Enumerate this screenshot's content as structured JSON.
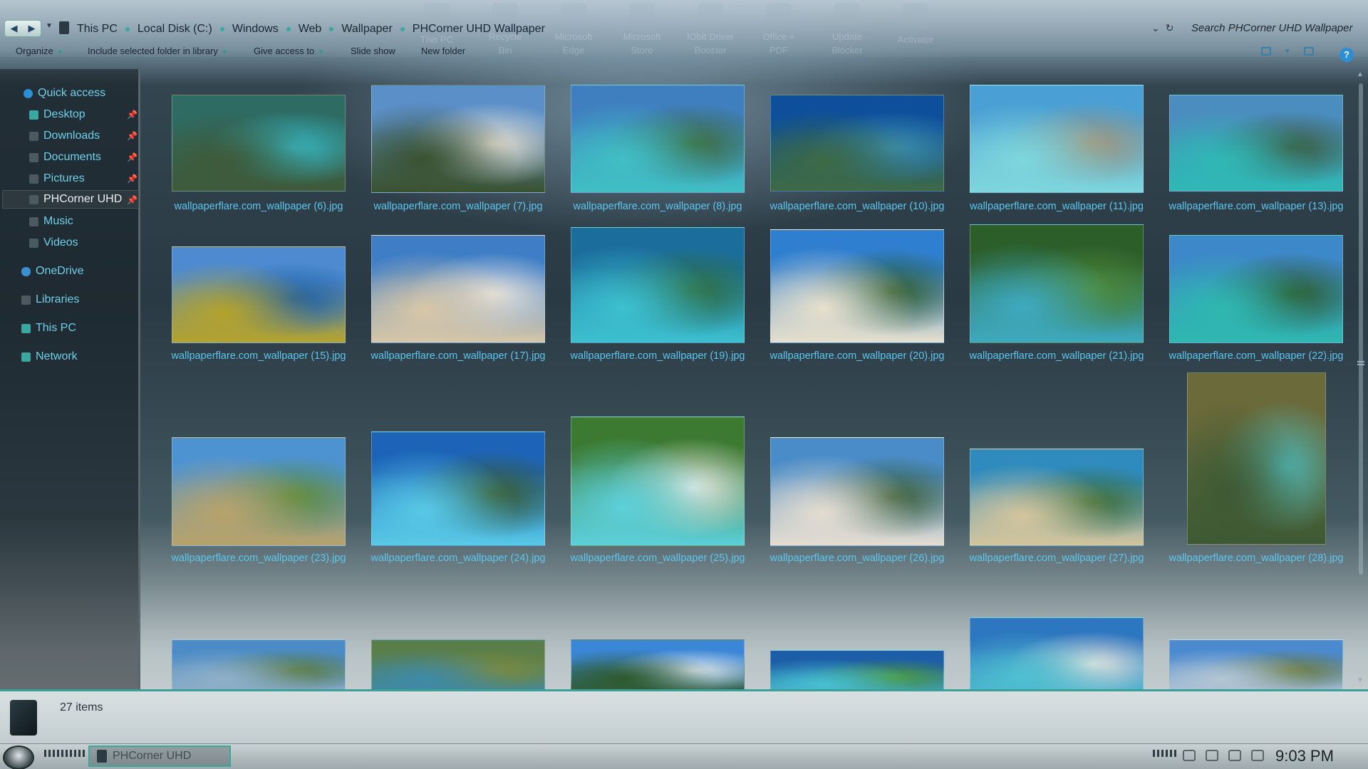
{
  "desktop_icons": [
    {
      "label": "This PC"
    },
    {
      "label": "Recycle Bin"
    },
    {
      "label": "Microsoft Edge"
    },
    {
      "label": "Microsoft Store"
    },
    {
      "label": "IObit Driver Booster"
    },
    {
      "label": "Office + PDF"
    },
    {
      "label": "Update Blocker"
    },
    {
      "label": "Activator"
    }
  ],
  "breadcrumb": [
    "This PC",
    "Local Disk (C:)",
    "Windows",
    "Web",
    "Wallpaper",
    "PHCorner UHD Wallpaper"
  ],
  "search": {
    "placeholder": "Search PHCorner UHD Wallpaper"
  },
  "toolbar": {
    "organize": "Organize",
    "include_library": "Include selected folder in library",
    "give_access": "Give access to",
    "slide_show": "Slide show",
    "new_folder": "New folder",
    "help": "?"
  },
  "nav": {
    "quick_access": "Quick access",
    "desktop": "Desktop",
    "downloads": "Downloads",
    "documents": "Documents",
    "pictures": "Pictures",
    "phcorner": "PHCorner UHD",
    "music": "Music",
    "videos": "Videos",
    "onedrive": "OneDrive",
    "libraries": "Libraries",
    "this_pc": "This PC",
    "network": "Network"
  },
  "files": [
    {
      "name": "wallpaperflare.com_wallpaper (6).jpg",
      "colors": [
        "#2e6b63",
        "#37b7c2",
        "#3e5a3a"
      ]
    },
    {
      "name": "wallpaperflare.com_wallpaper (7).jpg",
      "colors": [
        "#5b8fc8",
        "#e9e2d6",
        "#3a5230"
      ]
    },
    {
      "name": "wallpaperflare.com_wallpaper (8).jpg",
      "colors": [
        "#3f7fc0",
        "#3d6a3a",
        "#40bfc4"
      ]
    },
    {
      "name": "wallpaperflare.com_wallpaper (10).jpg",
      "colors": [
        "#0d4f9a",
        "#3c8fb0",
        "#3d6a45"
      ]
    },
    {
      "name": "wallpaperflare.com_wallpaper (11).jpg",
      "colors": [
        "#4aa0d4",
        "#a39478",
        "#7fd6dc"
      ]
    },
    {
      "name": "wallpaperflare.com_wallpaper (13).jpg",
      "colors": [
        "#4b8dbf",
        "#3a5a3c",
        "#2fb8b4"
      ]
    },
    {
      "name": "wallpaperflare.com_wallpaper (15).jpg",
      "colors": [
        "#4d8ad0",
        "#1e5ea0",
        "#b4a22c"
      ]
    },
    {
      "name": "wallpaperflare.com_wallpaper (17).jpg",
      "colors": [
        "#3f7ec6",
        "#e6e3de",
        "#d8c7a8"
      ]
    },
    {
      "name": "wallpaperflare.com_wallpaper (19).jpg",
      "colors": [
        "#1b6e9c",
        "#2f6d3e",
        "#3dc0cf"
      ]
    },
    {
      "name": "wallpaperflare.com_wallpaper (20).jpg",
      "colors": [
        "#2f7fd0",
        "#2e5a2a",
        "#e7e0cc"
      ]
    },
    {
      "name": "wallpaperflare.com_wallpaper (21).jpg",
      "colors": [
        "#2c5e2a",
        "#4f8a3a",
        "#3eaac0"
      ]
    },
    {
      "name": "wallpaperflare.com_wallpaper (22).jpg",
      "colors": [
        "#3d88c8",
        "#2c5a2a",
        "#2fb8b0"
      ]
    },
    {
      "name": "wallpaperflare.com_wallpaper (23).jpg",
      "colors": [
        "#4d93d2",
        "#5b8a3a",
        "#b8a36a"
      ]
    },
    {
      "name": "wallpaperflare.com_wallpaper (24).jpg",
      "colors": [
        "#1d64b8",
        "#3a5a2a",
        "#58c9e6"
      ]
    },
    {
      "name": "wallpaperflare.com_wallpaper (25).jpg",
      "colors": [
        "#3c7a32",
        "#e8e8e2",
        "#5cd0da"
      ]
    },
    {
      "name": "wallpaperflare.com_wallpaper (26).jpg",
      "colors": [
        "#4a8cc8",
        "#3a5c32",
        "#e5ddd0"
      ]
    },
    {
      "name": "wallpaperflare.com_wallpaper (27).jpg",
      "colors": [
        "#2f8bbd",
        "#3b6b33",
        "#d4c59c"
      ]
    },
    {
      "name": "wallpaperflare.com_wallpaper (28).jpg",
      "colors": [
        "#6a6a3a",
        "#4fb5b4",
        "#3d5a34"
      ]
    },
    {
      "name": "",
      "colors": [
        "#4c8cc6",
        "#5b7a3c",
        "#8fb0c8"
      ]
    },
    {
      "name": "",
      "colors": [
        "#5a7e4a",
        "#7d8a3c",
        "#3e8aa8"
      ]
    },
    {
      "name": "",
      "colors": [
        "#3b86d6",
        "#dfe8f0",
        "#2e5a2c"
      ]
    },
    {
      "name": "",
      "colors": [
        "#1d5ea8",
        "#4e9a3a",
        "#48c0d0"
      ]
    },
    {
      "name": "",
      "colors": [
        "#2d76c0",
        "#e8e5de",
        "#4fc0d0"
      ]
    },
    {
      "name": "",
      "colors": [
        "#4c8ad0",
        "#6b7a3a",
        "#b3c6d4"
      ]
    }
  ],
  "status": {
    "item_count": "27 items"
  },
  "taskbar": {
    "window_label": "PHCorner UHD",
    "clock": "9:03 PM"
  }
}
